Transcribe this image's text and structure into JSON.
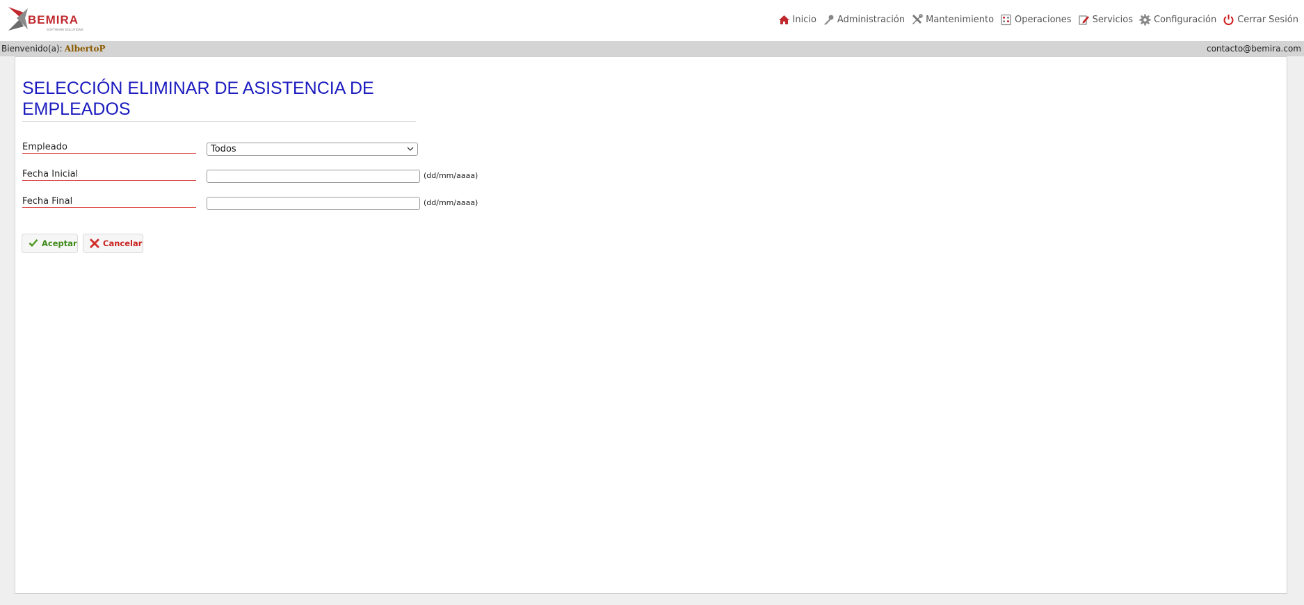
{
  "logo": {
    "text": "BEMIRA",
    "tagline": "SOFTWARE SOLUTIONS",
    "colors": {
      "primary": "#c0282d",
      "secondary": "#6b6b6b"
    }
  },
  "nav": [
    {
      "icon": "home-icon",
      "label": "Inicio"
    },
    {
      "icon": "key-icon",
      "label": "Administración"
    },
    {
      "icon": "tools-icon",
      "label": "Mantenimiento"
    },
    {
      "icon": "calculator-icon",
      "label": "Operaciones"
    },
    {
      "icon": "edit-icon",
      "label": "Servicios"
    },
    {
      "icon": "gear-icon",
      "label": "Configuración"
    },
    {
      "icon": "power-icon",
      "label": "Cerrar Sesión"
    }
  ],
  "welcome": {
    "prefix": "Bienvenido(a):",
    "user": "AlbertoP",
    "email": "contacto@bemira.com"
  },
  "page": {
    "title": "SELECCIÓN ELIMINAR DE ASISTENCIA DE EMPLEADOS",
    "fields": {
      "empleado": {
        "label": "Empleado",
        "value": "Todos"
      },
      "fecha_inicial": {
        "label": "Fecha Inicial",
        "value": "",
        "hint": "(dd/mm/aaaa)"
      },
      "fecha_final": {
        "label": "Fecha Final",
        "value": "",
        "hint": "(dd/mm/aaaa)"
      }
    },
    "buttons": {
      "accept": "Aceptar",
      "cancel": "Cancelar"
    }
  },
  "colors": {
    "title": "#1a1abf",
    "label_underline": "#dd4444",
    "accept": "#3e8a1a",
    "cancel": "#c9221e",
    "user": "#8a5a00"
  }
}
